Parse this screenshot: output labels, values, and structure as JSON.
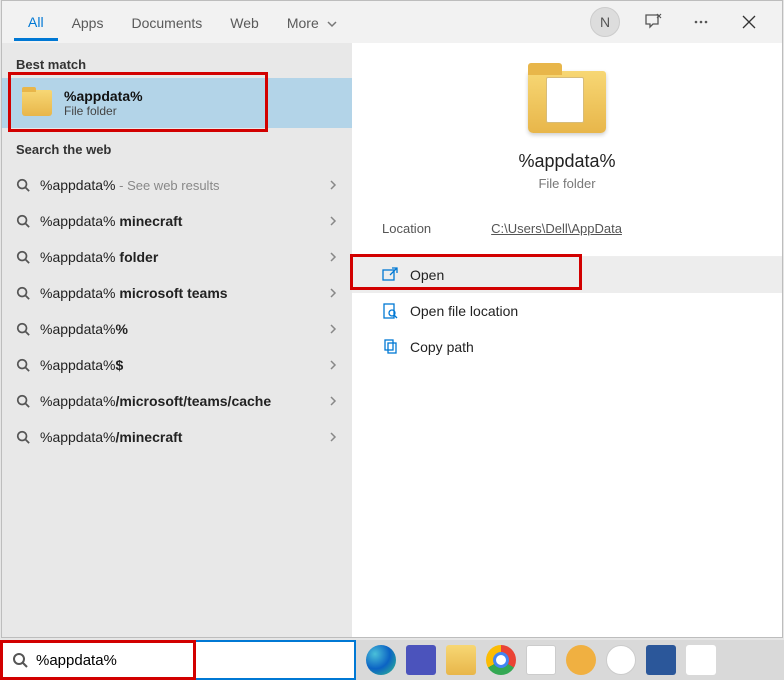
{
  "tabs": {
    "all": "All",
    "apps": "Apps",
    "documents": "Documents",
    "web": "Web",
    "more": "More"
  },
  "user_initial": "N",
  "sections": {
    "best_match": "Best match",
    "search_web": "Search the web"
  },
  "best_match": {
    "title": "%appdata%",
    "subtitle": "File folder"
  },
  "web_results": [
    {
      "prefix": "%appdata%",
      "suffix": "",
      "hint": " - See web results"
    },
    {
      "prefix": "%appdata%",
      "suffix": " minecraft",
      "hint": ""
    },
    {
      "prefix": "%appdata%",
      "suffix": " folder",
      "hint": ""
    },
    {
      "prefix": "%appdata%",
      "suffix": " microsoft teams",
      "hint": ""
    },
    {
      "prefix": "%appdata%",
      "suffix": "%",
      "hint": ""
    },
    {
      "prefix": "%appdata%",
      "suffix": "$",
      "hint": ""
    },
    {
      "prefix": "%appdata%",
      "suffix": "/microsoft/teams/cache",
      "hint": ""
    },
    {
      "prefix": "%appdata%",
      "suffix": "/minecraft",
      "hint": ""
    }
  ],
  "preview": {
    "title": "%appdata%",
    "subtitle": "File folder",
    "location_label": "Location",
    "location_value": "C:\\Users\\Dell\\AppData"
  },
  "actions": {
    "open": "Open",
    "open_location": "Open file location",
    "copy_path": "Copy path"
  },
  "search_input": "%appdata%"
}
